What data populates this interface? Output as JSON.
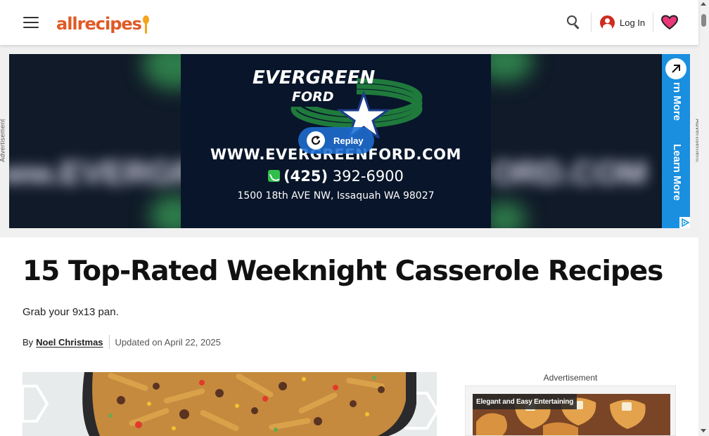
{
  "header": {
    "logo_text": "allrecipes",
    "login_label": "Log In",
    "icons": [
      "menu-icon",
      "search-icon",
      "user-icon",
      "heart-icon"
    ],
    "colors": {
      "logo": "#e05a26",
      "user_icon": "#ce2c1d",
      "heart": "#e8387a"
    }
  },
  "top_ad": {
    "side_label": "Advertisement",
    "brand_line1": "EVERGREEN",
    "brand_line2": "FORD",
    "url": "WWW.EVERGREENFORD.COM",
    "phone_area": "(425)",
    "phone_number": "392-6900",
    "address": "1500 18th AVE NW, Issaquah WA 98027",
    "replay_label": "Replay",
    "learn_more_partial": "rn More",
    "learn_more": "Learn More",
    "colors": {
      "background": "#08152a",
      "learn_more": "#1a8fe0",
      "swoosh": "#1f7a3c"
    }
  },
  "article": {
    "title": "15 Top-Rated Weeknight Casserole Recipes",
    "subtitle": "Grab your 9x13 pan.",
    "byline_prefix": "By",
    "author": "Noel Christmas",
    "updated": "Updated on April 22, 2025"
  },
  "right_ad": {
    "label": "Advertisement",
    "tag": "Elegant and Easy Entertaining"
  }
}
